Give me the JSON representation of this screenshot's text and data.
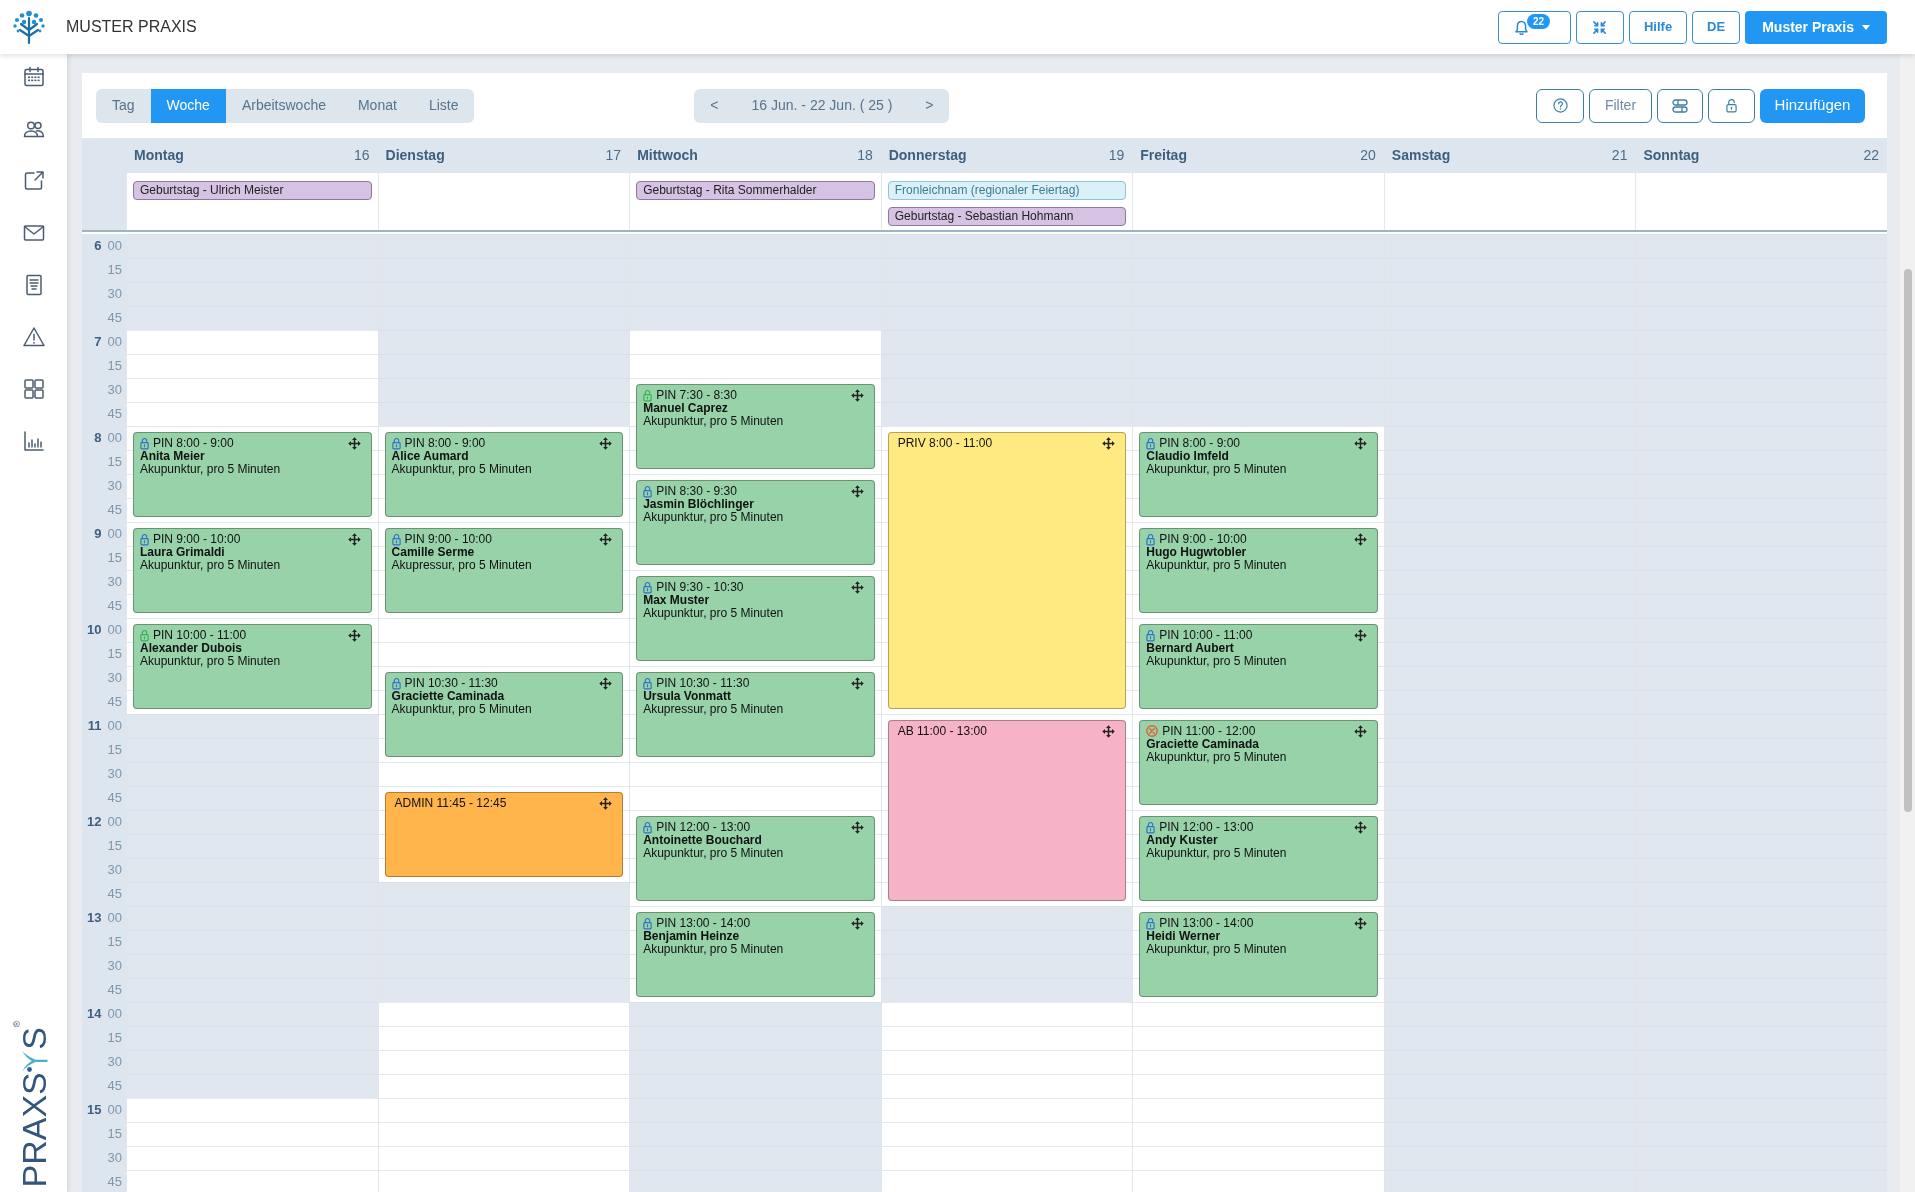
{
  "header": {
    "brand": "MUSTER PRAXIS",
    "notifications": "22",
    "buttons": [
      {
        "label": "Hilfe"
      },
      {
        "label": "DE"
      }
    ],
    "account": "Muster Praxis"
  },
  "brand_logo": {
    "text_start": "PRAXS",
    "text_end": "S",
    "registered": "®"
  },
  "toolbar": {
    "views": [
      {
        "label": "Tag",
        "selected": false
      },
      {
        "label": "Woche",
        "selected": true
      },
      {
        "label": "Arbeitswoche",
        "selected": false
      },
      {
        "label": "Monat",
        "selected": false
      },
      {
        "label": "Liste",
        "selected": false
      }
    ],
    "range": {
      "prev": "<",
      "label": "16 Jun. - 22 Jun. ( 25 )",
      "next": ">"
    },
    "filter": "Filter",
    "add": "Hinzufügen"
  },
  "calendar": {
    "days": [
      {
        "name": "Montag",
        "date": "16",
        "all_day": [
          {
            "kind": "birthday",
            "label": "Geburtstag - Ulrich Meister",
            "color": "#d6c2e3"
          }
        ],
        "events": [
          {
            "title": "PIN 8:00 - 9:00",
            "name": "Anita Meier",
            "service": "Akupunktur, pro 5 Minuten",
            "color": "#97d2a9",
            "icon": {
              "kind": "lock",
              "color": "#2f6fd0"
            }
          },
          {
            "title": "PIN 9:00 - 10:00",
            "name": "Laura Grimaldi",
            "service": "Akupunktur, pro 5 Minuten",
            "color": "#97d2a9",
            "icon": {
              "kind": "lock",
              "color": "#2f6fd0"
            }
          },
          {
            "title": "PIN 10:00 - 11:00",
            "name": "Alexander Dubois",
            "service": "Akupunktur, pro 5 Minuten",
            "color": "#97d2a9",
            "icon": {
              "kind": "lock",
              "color": "#37b24d"
            }
          }
        ]
      },
      {
        "name": "Dienstag",
        "date": "17",
        "events": [
          {
            "title": "PIN 8:00 - 9:00",
            "name": "Alice Aumard",
            "service": "Akupunktur, pro 5 Minuten",
            "color": "#97d2a9",
            "icon": {
              "kind": "lock",
              "color": "#2f6fd0"
            }
          },
          {
            "title": "PIN 9:00 - 10:00",
            "name": "Camille Serme",
            "service": "Akupressur, pro 5 Minuten",
            "color": "#97d2a9",
            "icon": {
              "kind": "lock",
              "color": "#2f6fd0"
            }
          },
          {
            "title": "PIN 10:30 - 11:30",
            "name": "Graciette Caminada",
            "service": "Akupunktur, pro 5 Minuten",
            "color": "#97d2a9",
            "icon": {
              "kind": "lock",
              "color": "#2f6fd0"
            }
          },
          {
            "title": "ADMIN 11:45 - 12:45",
            "color": "#ffb54c"
          }
        ]
      },
      {
        "name": "Mittwoch",
        "date": "18",
        "all_day": [
          {
            "kind": "birthday",
            "label": "Geburtstag - Rita Sommerhalder",
            "color": "#d6c2e3"
          }
        ],
        "events": [
          {
            "title": "PIN 7:30 - 8:30",
            "name": "Manuel Caprez",
            "service": "Akupunktur, pro 5 Minuten",
            "color": "#97d2a9",
            "icon": {
              "kind": "lock",
              "color": "#37b24d"
            }
          },
          {
            "title": "PIN 8:30 - 9:30",
            "name": "Jasmin Blöchlinger",
            "service": "Akupunktur, pro 5 Minuten",
            "color": "#97d2a9",
            "icon": {
              "kind": "lock",
              "color": "#2f6fd0"
            }
          },
          {
            "title": "PIN 9:30 - 10:30",
            "name": "Max Muster",
            "service": "Akupunktur, pro 5 Minuten",
            "color": "#97d2a9",
            "icon": {
              "kind": "lock",
              "color": "#2f6fd0"
            }
          },
          {
            "title": "PIN 10:30 - 11:30",
            "name": "Ursula Vonmatt",
            "service": "Akupressur, pro 5 Minuten",
            "color": "#97d2a9",
            "icon": {
              "kind": "lock",
              "color": "#2f6fd0"
            }
          },
          {
            "title": "PIN 12:00 - 13:00",
            "name": "Antoinette Bouchard",
            "service": "Akupunktur, pro 5 Minuten",
            "color": "#97d2a9",
            "icon": {
              "kind": "lock",
              "color": "#2f6fd0"
            }
          },
          {
            "title": "PIN 13:00 - 14:00",
            "name": "Benjamin Heinze",
            "service": "Akupunktur, pro 5 Minuten",
            "color": "#97d2a9",
            "icon": {
              "kind": "lock",
              "color": "#2f6fd0"
            }
          }
        ]
      },
      {
        "name": "Donnerstag",
        "date": "19",
        "all_day": [
          {
            "kind": "holiday",
            "label": "Fronleichnam (regionaler Feiertag)",
            "color": "#dcf0fa"
          },
          {
            "kind": "birthday",
            "label": "Geburtstag - Sebastian Hohmann",
            "color": "#d6c2e3"
          }
        ],
        "events": [
          {
            "title": "PRIV 8:00 - 11:00",
            "color": "#ffea82"
          },
          {
            "title": "AB 11:00 - 13:00",
            "color": "#f6b2c6"
          }
        ]
      },
      {
        "name": "Freitag",
        "date": "20",
        "events": [
          {
            "title": "PIN 8:00 - 9:00",
            "name": "Claudio Imfeld",
            "service": "Akupunktur, pro 5 Minuten",
            "color": "#97d2a9",
            "icon": {
              "kind": "lock",
              "color": "#2f6fd0"
            }
          },
          {
            "title": "PIN 9:00 - 10:00",
            "name": "Hugo Hugwtobler",
            "service": "Akupunktur, pro 5 Minuten",
            "color": "#97d2a9",
            "icon": {
              "kind": "lock",
              "color": "#2f6fd0"
            }
          },
          {
            "title": "PIN 10:00 - 11:00",
            "name": "Bernard Aubert",
            "service": "Akupunktur, pro 5 Minuten",
            "color": "#97d2a9",
            "icon": {
              "kind": "lock",
              "color": "#2f6fd0"
            }
          },
          {
            "title": "PIN 11:00 - 12:00",
            "name": "Graciette Caminada",
            "service": "Akupunktur, pro 5 Minuten",
            "color": "#97d2a9",
            "icon": {
              "kind": "cancel",
              "color": "#e0603a"
            }
          },
          {
            "title": "PIN 12:00 - 13:00",
            "name": "Andy Kuster",
            "service": "Akupunktur, pro 5 Minuten",
            "color": "#97d2a9",
            "icon": {
              "kind": "lock",
              "color": "#2f6fd0"
            }
          },
          {
            "title": "PIN 13:00 - 14:00",
            "name": "Heidi Werner",
            "service": "Akupunktur, pro 5 Minuten",
            "color": "#97d2a9",
            "icon": {
              "kind": "lock",
              "color": "#2f6fd0"
            }
          }
        ]
      },
      {
        "name": "Samstag",
        "date": "21"
      },
      {
        "name": "Sonntag",
        "date": "22"
      }
    ],
    "time_rows": [
      {
        "hour": "6",
        "minute": "00",
        "open": [
          false,
          false,
          false,
          false,
          false,
          false,
          false
        ]
      },
      {
        "minute": "15",
        "open": [
          false,
          false,
          false,
          false,
          false,
          false,
          false
        ]
      },
      {
        "minute": "30",
        "open": [
          false,
          false,
          false,
          false,
          false,
          false,
          false
        ]
      },
      {
        "minute": "45",
        "open": [
          false,
          false,
          false,
          false,
          false,
          false,
          false
        ]
      },
      {
        "hour": "7",
        "minute": "00",
        "open": [
          true,
          false,
          true,
          false,
          false,
          false,
          false
        ]
      },
      {
        "minute": "15",
        "open": [
          true,
          false,
          true,
          false,
          false,
          false,
          false
        ]
      },
      {
        "minute": "30",
        "open": [
          true,
          false,
          true,
          false,
          false,
          false,
          false
        ]
      },
      {
        "minute": "45",
        "open": [
          true,
          false,
          true,
          false,
          false,
          false,
          false
        ]
      },
      {
        "hour": "8",
        "minute": "00",
        "open": [
          true,
          true,
          true,
          true,
          true,
          false,
          false
        ]
      },
      {
        "minute": "15",
        "open": [
          true,
          true,
          true,
          true,
          true,
          false,
          false
        ]
      },
      {
        "minute": "30",
        "open": [
          true,
          true,
          true,
          true,
          true,
          false,
          false
        ]
      },
      {
        "minute": "45",
        "open": [
          true,
          true,
          true,
          true,
          true,
          false,
          false
        ]
      },
      {
        "hour": "9",
        "minute": "00",
        "open": [
          true,
          true,
          true,
          true,
          true,
          false,
          false
        ]
      },
      {
        "minute": "15",
        "open": [
          true,
          true,
          true,
          true,
          true,
          false,
          false
        ]
      },
      {
        "minute": "30",
        "open": [
          true,
          true,
          true,
          true,
          true,
          false,
          false
        ]
      },
      {
        "minute": "45",
        "open": [
          true,
          true,
          true,
          true,
          true,
          false,
          false
        ]
      },
      {
        "hour": "10",
        "minute": "00",
        "open": [
          true,
          true,
          true,
          true,
          true,
          false,
          false
        ]
      },
      {
        "minute": "15",
        "open": [
          true,
          true,
          true,
          true,
          true,
          false,
          false
        ]
      },
      {
        "minute": "30",
        "open": [
          true,
          true,
          true,
          true,
          true,
          false,
          false
        ]
      },
      {
        "minute": "45",
        "open": [
          true,
          true,
          true,
          true,
          true,
          false,
          false
        ]
      },
      {
        "hour": "11",
        "minute": "00",
        "open": [
          false,
          true,
          true,
          true,
          true,
          false,
          false
        ]
      },
      {
        "minute": "15",
        "open": [
          false,
          true,
          true,
          true,
          true,
          false,
          false
        ]
      },
      {
        "minute": "30",
        "open": [
          false,
          true,
          true,
          true,
          true,
          false,
          false
        ]
      },
      {
        "minute": "45",
        "open": [
          false,
          true,
          true,
          true,
          true,
          false,
          false
        ]
      },
      {
        "hour": "12",
        "minute": "00",
        "open": [
          false,
          true,
          true,
          true,
          true,
          false,
          false
        ]
      },
      {
        "minute": "15",
        "open": [
          false,
          true,
          true,
          true,
          true,
          false,
          false
        ]
      },
      {
        "minute": "30",
        "open": [
          false,
          true,
          true,
          true,
          true,
          false,
          false
        ]
      },
      {
        "minute": "45",
        "open": [
          false,
          false,
          true,
          true,
          true,
          false,
          false
        ]
      },
      {
        "hour": "13",
        "minute": "00",
        "open": [
          false,
          false,
          true,
          false,
          true,
          false,
          false
        ]
      },
      {
        "minute": "15",
        "open": [
          false,
          false,
          true,
          false,
          true,
          false,
          false
        ]
      },
      {
        "minute": "30",
        "open": [
          false,
          false,
          true,
          false,
          true,
          false,
          false
        ]
      },
      {
        "minute": "45",
        "open": [
          false,
          false,
          true,
          false,
          true,
          false,
          false
        ]
      },
      {
        "hour": "14",
        "minute": "00",
        "open": [
          false,
          true,
          false,
          true,
          true,
          false,
          false
        ]
      },
      {
        "minute": "15",
        "open": [
          false,
          true,
          false,
          true,
          true,
          false,
          false
        ]
      },
      {
        "minute": "30",
        "open": [
          false,
          true,
          false,
          true,
          true,
          false,
          false
        ]
      },
      {
        "minute": "45",
        "open": [
          false,
          true,
          false,
          true,
          true,
          false,
          false
        ]
      },
      {
        "hour": "15",
        "minute": "00",
        "open": [
          true,
          true,
          false,
          true,
          true,
          false,
          false
        ]
      },
      {
        "minute": "15",
        "open": [
          true,
          true,
          false,
          true,
          true,
          false,
          false
        ]
      },
      {
        "minute": "30",
        "open": [
          true,
          true,
          false,
          true,
          true,
          false,
          false
        ]
      },
      {
        "minute": "45",
        "open": [
          true,
          true,
          false,
          true,
          true,
          false,
          false
        ]
      }
    ]
  }
}
